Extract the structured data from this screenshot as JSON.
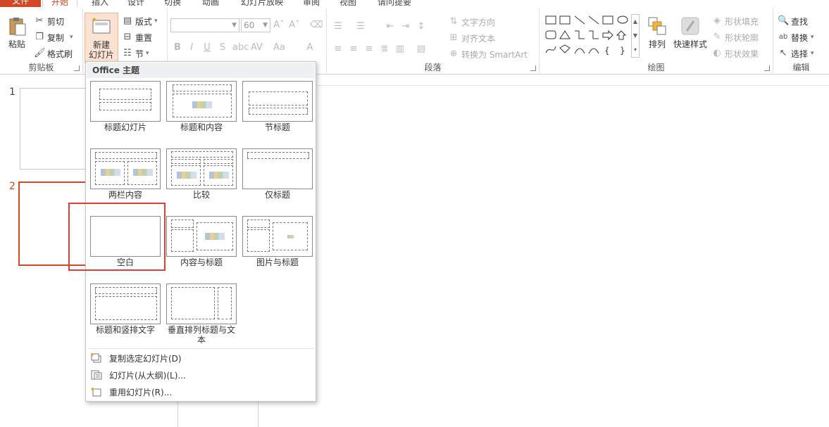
{
  "tabs": {
    "file": "文件",
    "home": "开始",
    "insert": "插入",
    "design": "设计",
    "transitions": "切换",
    "animations": "动画",
    "slideshow": "幻灯片放映",
    "review": "审阅",
    "view": "视图",
    "tell": "请问提要"
  },
  "clipboard": {
    "paste": "粘贴",
    "cut": "剪切",
    "copy": "复制",
    "format_painter": "格式刷",
    "label": "剪贴板"
  },
  "slides": {
    "new_slide_line1": "新建",
    "new_slide_line2": "幻灯片",
    "layout": "版式",
    "reset": "重置",
    "section": "节"
  },
  "font": {
    "size_value": "60",
    "font_value": ""
  },
  "paragraph": {
    "text_direction": "文字方向",
    "align_text": "对齐文本",
    "convert_smartart": "转换为 SmartArt",
    "label": "段落"
  },
  "drawing": {
    "arrange": "排列",
    "quick_styles": "快速样式",
    "shape_fill": "形状填充",
    "shape_outline": "形状轮廓",
    "shape_effects": "形状效果",
    "label": "绘图"
  },
  "editing": {
    "find": "查找",
    "replace": "替换",
    "select": "选择",
    "label": "编辑"
  },
  "thumbs": {
    "n1": "1",
    "n2": "2"
  },
  "menu": {
    "header": "Office 主题",
    "layouts": [
      "标题幻灯片",
      "标题和内容",
      "节标题",
      "两栏内容",
      "比较",
      "仅标题",
      "空白",
      "内容与标题",
      "图片与标题",
      "标题和竖排文字",
      "垂直排列标题与文本"
    ],
    "dup": "复制选定幻灯片(D)",
    "outline": "幻灯片(从大纲)(L)...",
    "reuse": "重用幻灯片(R)..."
  },
  "colors": {
    "accent": "#d24726",
    "highlight": "#e03c31"
  }
}
